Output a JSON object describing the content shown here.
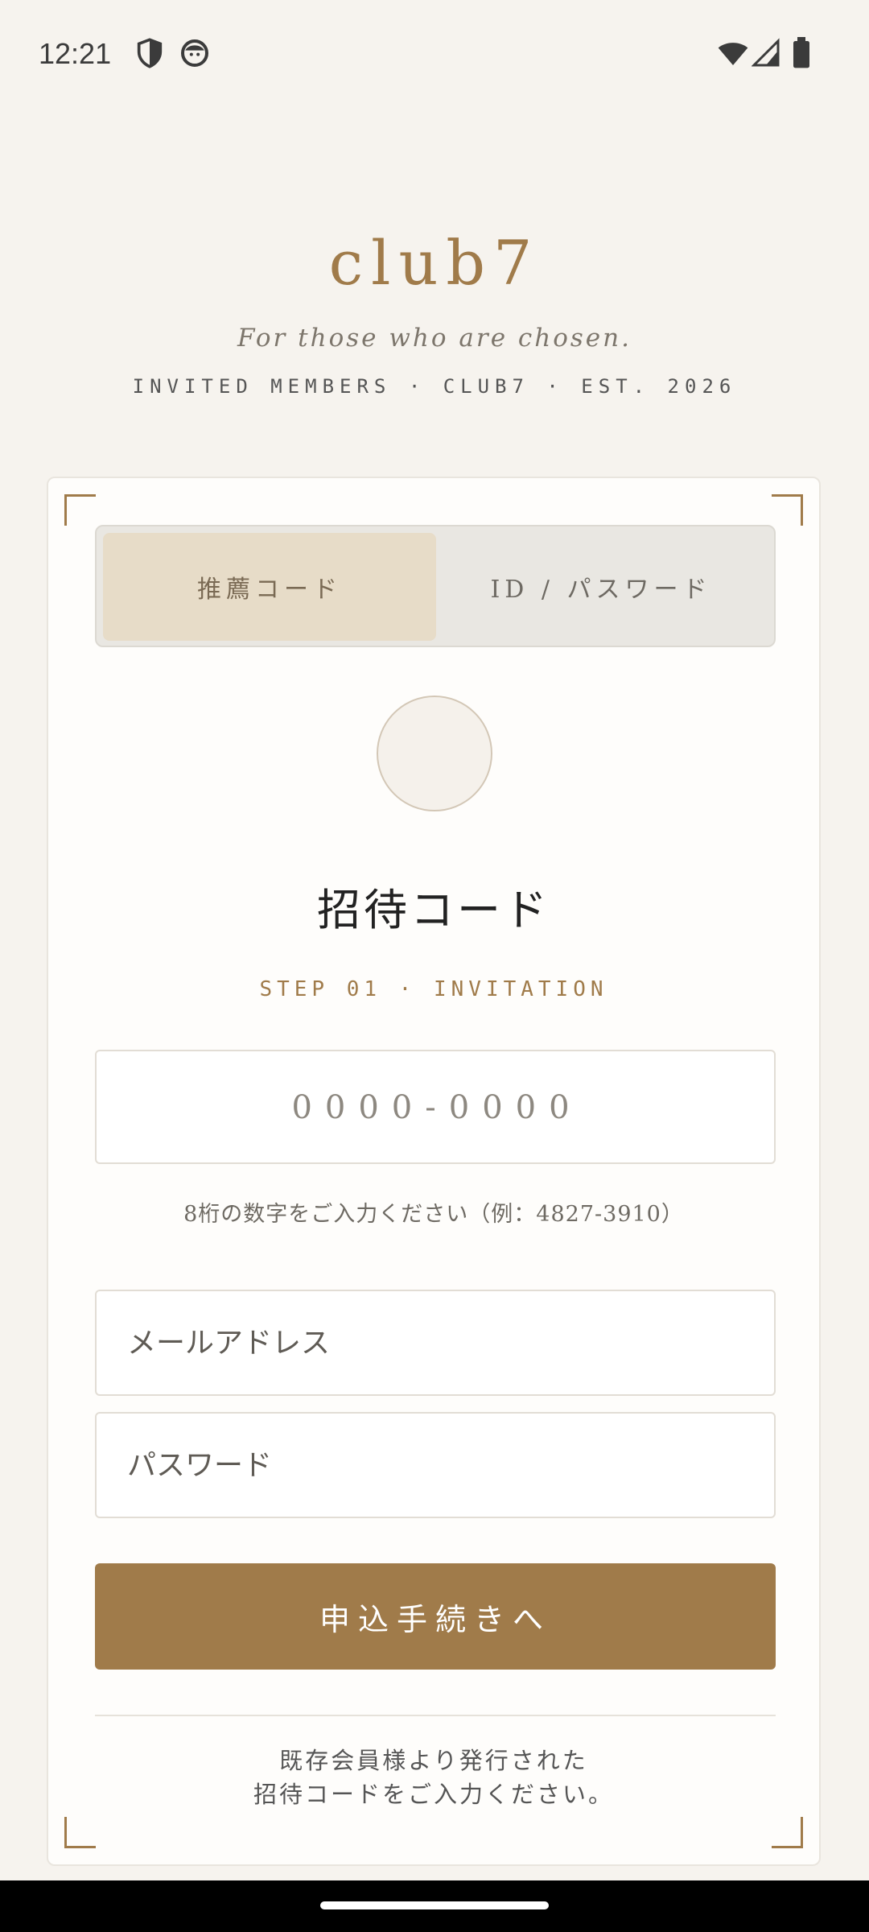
{
  "status_bar": {
    "time": "12:21",
    "left_icons": [
      "shield-icon",
      "face-icon"
    ],
    "right_icons": [
      "wifi-icon",
      "signal-icon",
      "battery-icon"
    ]
  },
  "header": {
    "brand": "club7",
    "tagline": "For those who are chosen.",
    "subline": "INVITED MEMBERS · CLUB7 · EST. 2026"
  },
  "tabs": [
    {
      "label": "推薦コード",
      "active": true
    },
    {
      "label": "ID / パスワード",
      "active": false
    }
  ],
  "form": {
    "title": "招待コード",
    "step": "STEP 01 · INVITATION",
    "code_placeholder": "0000-0000",
    "code_hint": "8桁の数字をご入力ください（例：4827-3910）",
    "email_placeholder": "メールアドレス",
    "password_placeholder": "パスワード",
    "submit_label": "申込手続きへ",
    "note_line1": "既存会員様より発行された",
    "note_line2": "招待コードをご入力ください。"
  },
  "colors": {
    "accent": "#a07b4a",
    "background": "#f6f3ee",
    "card": "#fefdfb",
    "active_tab": "#e7dcc8"
  }
}
